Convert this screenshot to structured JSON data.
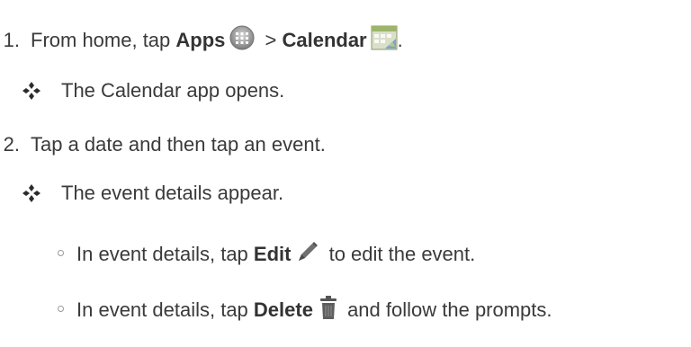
{
  "steps": [
    {
      "number": "1.",
      "parts": {
        "a": "From home, tap ",
        "apps": "Apps",
        "sep": " > ",
        "calendar": "Calendar",
        "end": "."
      },
      "icons": [
        "apps-grid-icon",
        "calendar-icon"
      ],
      "result": "The Calendar app opens."
    },
    {
      "number": "2.",
      "text": "Tap a date and then tap an event.",
      "result": "The event details appear.",
      "bullets": [
        {
          "a": "In event details, tap ",
          "bold": "Edit",
          "icon": "pencil-icon",
          "b": " to edit the event."
        },
        {
          "a": "In event details, tap ",
          "bold": "Delete",
          "icon": "trash-icon",
          "b": " and follow the prompts."
        }
      ]
    }
  ],
  "colors": {
    "text": "#3a3a3a",
    "result_marker": "#2b2b2b"
  }
}
